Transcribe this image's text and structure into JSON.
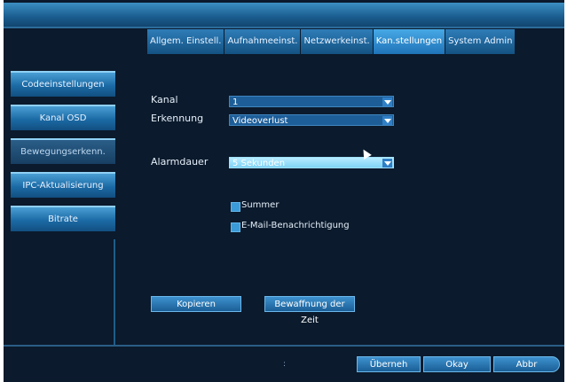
{
  "tabs": [
    {
      "label": "Allgem. Einstell."
    },
    {
      "label": "Aufnahmeeinst."
    },
    {
      "label": "Netzwerkeinst."
    },
    {
      "label": "Kan.stellungen"
    },
    {
      "label": "System Admin"
    }
  ],
  "sidebar": {
    "items": [
      {
        "label": "Codeeinstellungen"
      },
      {
        "label": "Kanal OSD"
      },
      {
        "label": "Bewegungserkenn."
      },
      {
        "label": "IPC-Aktualisierung"
      },
      {
        "label": "Bitrate"
      }
    ]
  },
  "form": {
    "kanal_label": "Kanal",
    "kanal_value": "1",
    "erkennung_label": "Erkennung",
    "erkennung_value": "Videoverlust",
    "alarmdauer_label": "Alarmdauer",
    "alarmdauer_value": "5 Sekunden",
    "summer_label": "Summer",
    "email_label": "E-Mail-Benachrichtigung"
  },
  "buttons": {
    "kopieren": "Kopieren",
    "bewaffnung": "Bewaffnung der Zeit",
    "uebernehmen": "Überneh",
    "okay": "Okay",
    "abbr": "Abbr"
  },
  "colors": {
    "background": "#0b1a2c",
    "accent": "#1f73b8",
    "active_tab": "#47a9e6"
  }
}
